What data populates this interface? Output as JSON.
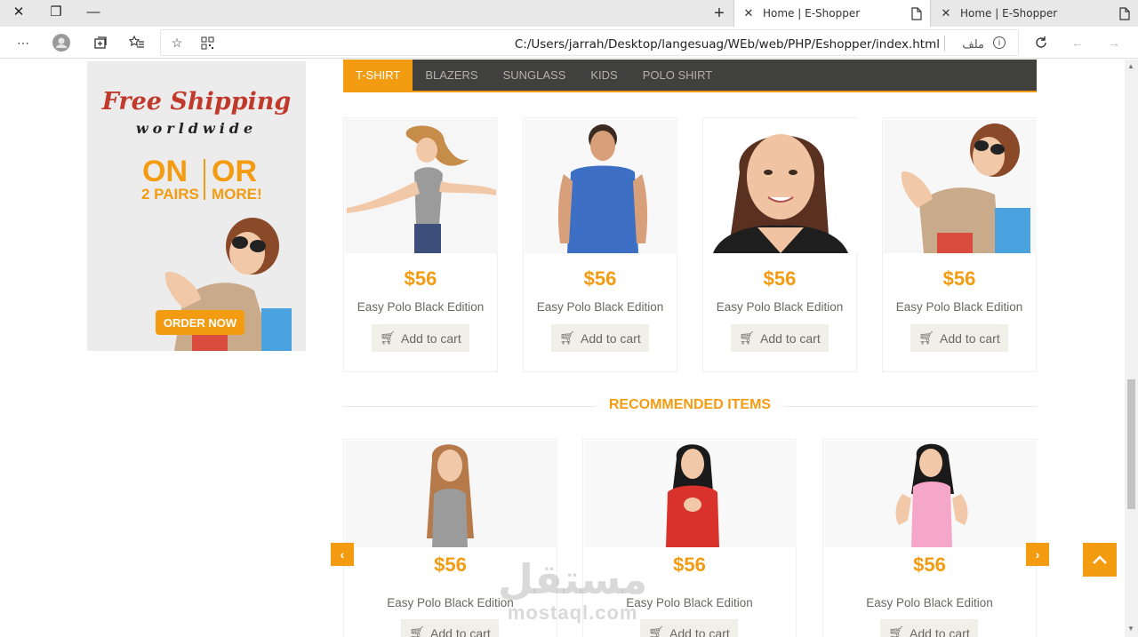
{
  "window": {
    "close_icon": "✕",
    "restore_icon": "❐",
    "minimize_icon": "—"
  },
  "tabs": [
    {
      "title": "Home | E-Shopper",
      "active": true
    },
    {
      "title": "Home | E-Shopper",
      "active": false
    }
  ],
  "addressbar": {
    "url": "C:/Users/jarrah/Desktop/langesuag/WEb/web/PHP/Eshopper/index.html",
    "file_label": "ملف"
  },
  "ad": {
    "title": "Free Shipping",
    "subtitle": "worldwide",
    "on": "ON",
    "or": "OR",
    "pairs": "2 PAIRS",
    "more": "MORE!",
    "button": "ORDER NOW"
  },
  "category_tabs": [
    "T-SHIRT",
    "BLAZERS",
    "SUNGLASS",
    "KIDS",
    "POLO SHIRT"
  ],
  "products": [
    {
      "price": "$56",
      "name": "Easy Polo Black Edition",
      "cart": "Add to cart"
    },
    {
      "price": "$56",
      "name": "Easy Polo Black Edition",
      "cart": "Add to cart"
    },
    {
      "price": "$56",
      "name": "Easy Polo Black Edition",
      "cart": "Add to cart"
    },
    {
      "price": "$56",
      "name": "Easy Polo Black Edition",
      "cart": "Add to cart"
    }
  ],
  "recommended": {
    "title": "RECOMMENDED ITEMS",
    "items": [
      {
        "price": "$56",
        "name": "Easy Polo Black Edition",
        "cart": "Add to cart"
      },
      {
        "price": "$56",
        "name": "Easy Polo Black Edition",
        "cart": "Add to cart"
      },
      {
        "price": "$56",
        "name": "Easy Polo Black Edition",
        "cart": "Add to cart"
      }
    ]
  },
  "watermark": {
    "arabic": "مستقل",
    "latin": "mostaql.com"
  },
  "colors": {
    "accent": "#f39c12",
    "tab_bg": "#40403e",
    "text": "#696763"
  }
}
